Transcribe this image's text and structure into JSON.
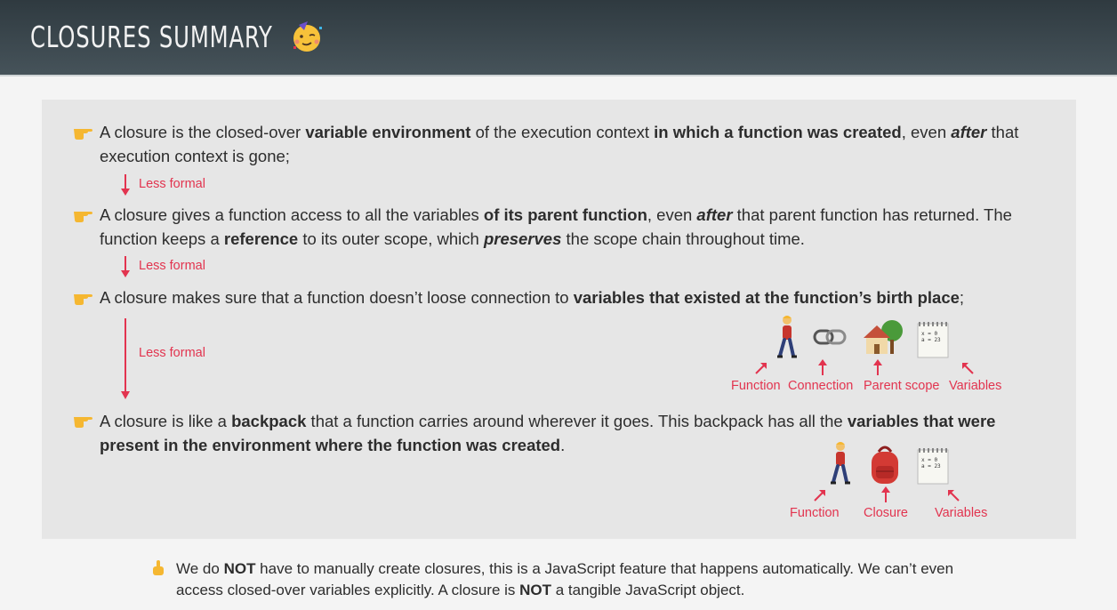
{
  "header": {
    "title": "Closures Summary"
  },
  "points": [
    {
      "segments": [
        {
          "t": "A closure is the closed-over ",
          "s": ""
        },
        {
          "t": "variable environment",
          "s": "b"
        },
        {
          "t": " of the execution context ",
          "s": ""
        },
        {
          "t": "in which a function was created",
          "s": "b"
        },
        {
          "t": ", even ",
          "s": ""
        },
        {
          "t": "after",
          "s": "i"
        },
        {
          "t": " that execution context is gone;",
          "s": ""
        }
      ]
    },
    {
      "segments": [
        {
          "t": "A closure gives a function access to all the variables ",
          "s": ""
        },
        {
          "t": "of its parent function",
          "s": "b"
        },
        {
          "t": ", even ",
          "s": ""
        },
        {
          "t": "after",
          "s": "i"
        },
        {
          "t": " that parent function has returned. The function keeps a ",
          "s": ""
        },
        {
          "t": "reference",
          "s": "b"
        },
        {
          "t": " to its outer scope, which ",
          "s": ""
        },
        {
          "t": "preserves",
          "s": "i"
        },
        {
          "t": " the scope chain throughout time.",
          "s": ""
        }
      ]
    },
    {
      "segments": [
        {
          "t": "A closure makes sure that a function doesn’t loose connection to ",
          "s": ""
        },
        {
          "t": "variables that existed at the function’s birth place",
          "s": "b"
        },
        {
          "t": ";",
          "s": ""
        }
      ]
    },
    {
      "segments": [
        {
          "t": "A closure is like a ",
          "s": ""
        },
        {
          "t": "backpack",
          "s": "b"
        },
        {
          "t": " that a function carries around wherever it goes. This backpack has all the ",
          "s": ""
        },
        {
          "t": "variables that were present in the environment where the function was created",
          "s": "b"
        },
        {
          "t": ".",
          "s": ""
        }
      ]
    }
  ],
  "less_formal": [
    "Less formal",
    "Less formal",
    "Less formal"
  ],
  "illustration1": {
    "labels": [
      "Function",
      "Connection",
      "Parent scope",
      "Variables"
    ],
    "icons": [
      "person-walking-icon",
      "chain-link-icon",
      "house-with-tree-icon",
      "notepad-icon"
    ]
  },
  "illustration2": {
    "labels": [
      "Function",
      "Closure",
      "Variables"
    ],
    "icons": [
      "person-walking-icon",
      "backpack-icon",
      "notepad-icon"
    ]
  },
  "notepad_text": [
    "x = 0",
    "a = 23"
  ],
  "note": {
    "segments": [
      {
        "t": "We do ",
        "s": ""
      },
      {
        "t": "NOT",
        "s": "b"
      },
      {
        "t": " have to manually create closures, this is a JavaScript feature that happens automatically. We can’t even access closed-over variables explicitly. A closure is ",
        "s": ""
      },
      {
        "t": "NOT",
        "s": "b"
      },
      {
        "t": " a tangible JavaScript object.",
        "s": ""
      }
    ]
  },
  "colors": {
    "accent": "#e2344f",
    "header": "#3b474d",
    "panel": "#e6e6e6",
    "hand": "#f5b731"
  }
}
